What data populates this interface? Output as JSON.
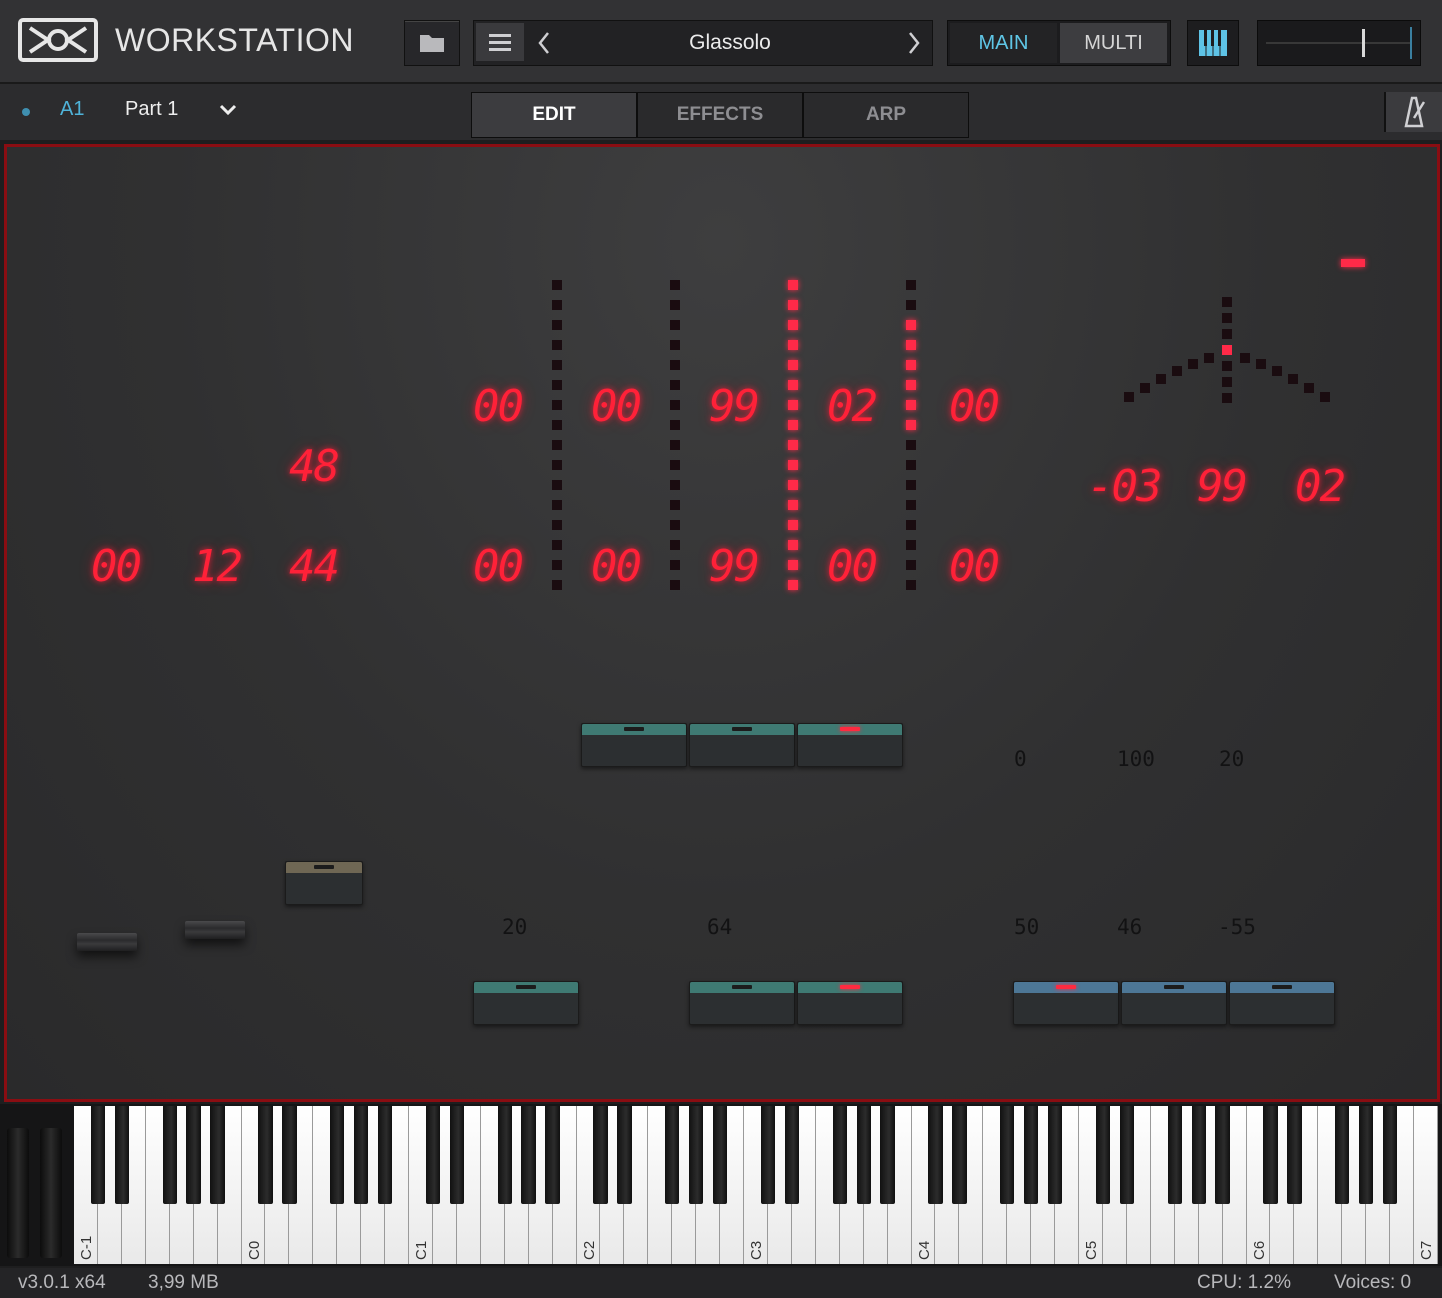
{
  "header": {
    "app_title": "WORKSTATION",
    "preset_name": "Glassolo",
    "main_label": "MAIN",
    "multi_label": "MULTI",
    "volume_level": 0.8
  },
  "part": {
    "slot": "A1",
    "name": "Part 1"
  },
  "tabs": [
    {
      "label": "EDIT",
      "active": true
    },
    {
      "label": "EFFECTS",
      "active": false
    },
    {
      "label": "ARP",
      "active": false
    }
  ],
  "panel": {
    "left_displays": [
      "00",
      "12",
      "44",
      "48"
    ],
    "top_row_displays": [
      "00",
      "00",
      "99",
      "02",
      "00"
    ],
    "bottom_row_displays": [
      "00",
      "00",
      "99",
      "00",
      "00"
    ],
    "right_displays": [
      "-03",
      "99",
      "02"
    ],
    "labels_upper": [
      "0",
      "100",
      "20"
    ],
    "labels_lower": [
      "20",
      "64",
      "50",
      "46",
      "-55"
    ]
  },
  "keyboard": {
    "octave_labels": [
      "C-1",
      "C0",
      "C1",
      "C2",
      "C3",
      "C4",
      "C5",
      "C6",
      "C7"
    ]
  },
  "status": {
    "version": "v3.0.1 x64",
    "memory": "3,99 MB",
    "cpu": "CPU: 1.2%",
    "voices": "Voices: 0"
  },
  "colors": {
    "accent": "#4fb3d9",
    "led_red": "#ff2138",
    "panel_border": "#8a0d12"
  }
}
